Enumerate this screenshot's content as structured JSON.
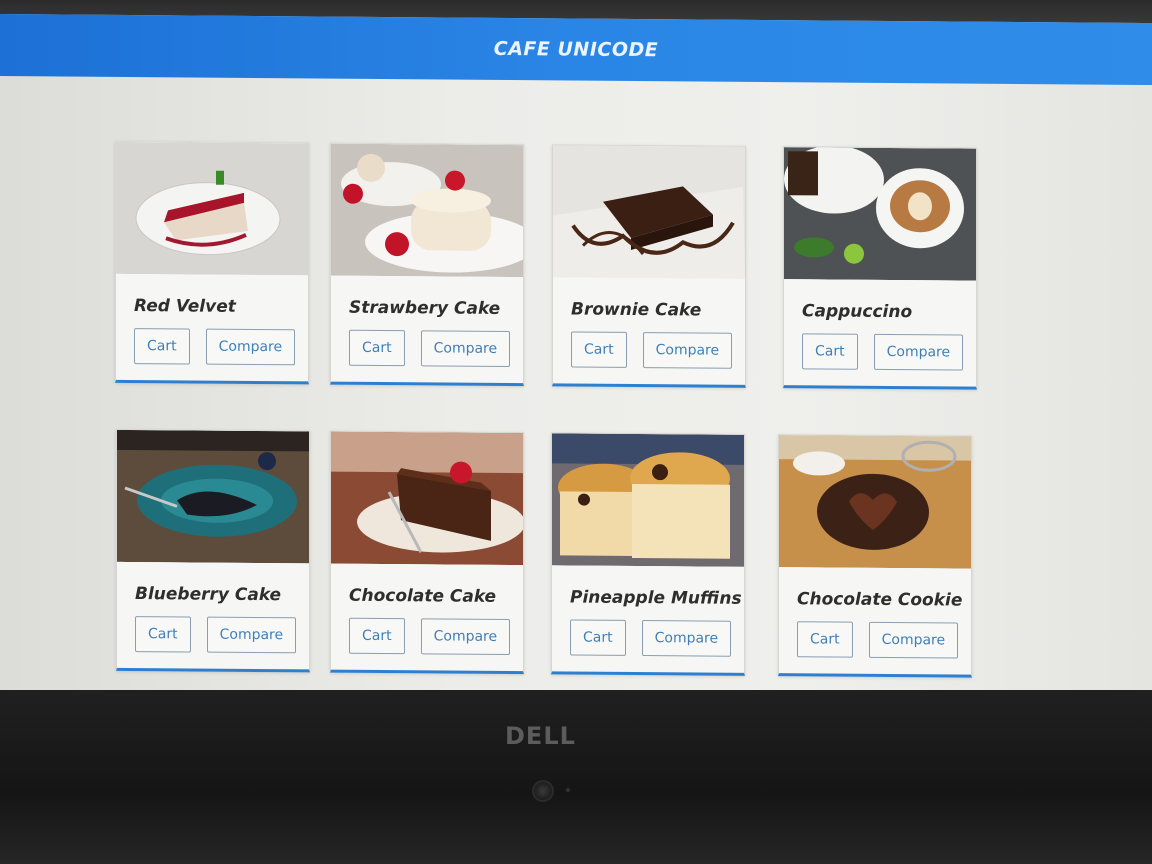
{
  "app": {
    "title": "CAFE UNICODE"
  },
  "device": {
    "brand": "DELL"
  },
  "cards": [
    {
      "title": "Red Velvet",
      "image_icon": "red-velvet-cake-image",
      "cart_label": "Cart",
      "compare_label": "Compare"
    },
    {
      "title": "Strawbery Cake",
      "image_icon": "strawberry-cake-image",
      "cart_label": "Cart",
      "compare_label": "Compare"
    },
    {
      "title": "Brownie Cake",
      "image_icon": "brownie-cake-image",
      "cart_label": "Cart",
      "compare_label": "Compare"
    },
    {
      "title": "Cappuccino",
      "image_icon": "cappuccino-image",
      "cart_label": "Cart",
      "compare_label": "Compare"
    },
    {
      "title": "Blueberry Cake",
      "image_icon": "blueberry-cake-image",
      "cart_label": "Cart",
      "compare_label": "Compare"
    },
    {
      "title": "Chocolate Cake",
      "image_icon": "chocolate-cake-image",
      "cart_label": "Cart",
      "compare_label": "Compare"
    },
    {
      "title": "Pineapple Muffins",
      "image_icon": "muffins-image",
      "cart_label": "Cart",
      "compare_label": "Compare"
    },
    {
      "title": "Chocolate Cookie",
      "image_icon": "chocolate-cookie-image",
      "cart_label": "Cart",
      "compare_label": "Compare"
    }
  ],
  "colors": {
    "header": "#2a86e6",
    "accent": "#2e7fd0",
    "button_text": "#3f7fb8"
  }
}
